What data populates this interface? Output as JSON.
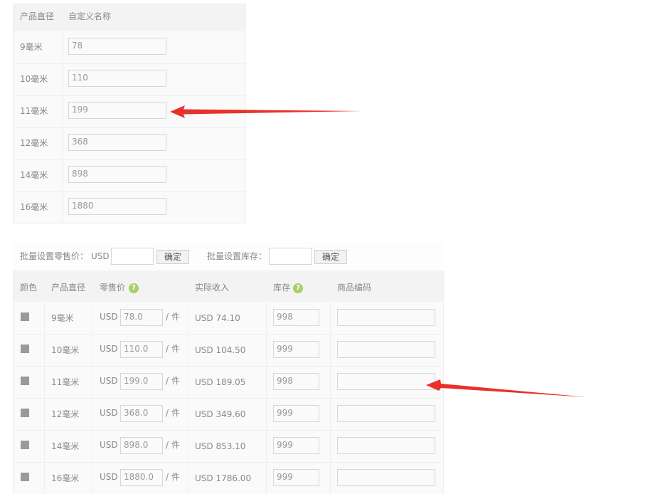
{
  "table1": {
    "headers": [
      "产品直径",
      "自定义名称"
    ],
    "rows": [
      {
        "size": "9毫米",
        "name": "78"
      },
      {
        "size": "10毫米",
        "name": "110"
      },
      {
        "size": "11毫米",
        "name": "199"
      },
      {
        "size": "12毫米",
        "name": "368"
      },
      {
        "size": "14毫米",
        "name": "898"
      },
      {
        "size": "16毫米",
        "name": "1880"
      }
    ]
  },
  "bulk": {
    "price_label": "批量设置零售价：",
    "currency": "USD",
    "price_value": "",
    "confirm": "确定",
    "stock_label": "批量设置库存：",
    "stock_value": ""
  },
  "table2": {
    "headers": {
      "color": "颜色",
      "size": "产品直径",
      "price": "零售价",
      "income": "实际收入",
      "stock": "库存",
      "sku": "商品编码"
    },
    "help_glyph": "?",
    "unit": "/ 件",
    "currency": "USD",
    "rows": [
      {
        "size": "9毫米",
        "price": "78.0",
        "income": "USD 74.10",
        "stock": "998",
        "sku": ""
      },
      {
        "size": "10毫米",
        "price": "110.0",
        "income": "USD 104.50",
        "stock": "999",
        "sku": ""
      },
      {
        "size": "11毫米",
        "price": "199.0",
        "income": "USD 189.05",
        "stock": "998",
        "sku": ""
      },
      {
        "size": "12毫米",
        "price": "368.0",
        "income": "USD 349.60",
        "stock": "999",
        "sku": ""
      },
      {
        "size": "14毫米",
        "price": "898.0",
        "income": "USD 853.10",
        "stock": "999",
        "sku": ""
      },
      {
        "size": "16毫米",
        "price": "1880.0",
        "income": "USD 1786.00",
        "stock": "999",
        "sku": ""
      }
    ]
  },
  "colors": {
    "arrow": "#e8312a",
    "help": "#a7d06a",
    "swatch": "#9a9a9a"
  }
}
